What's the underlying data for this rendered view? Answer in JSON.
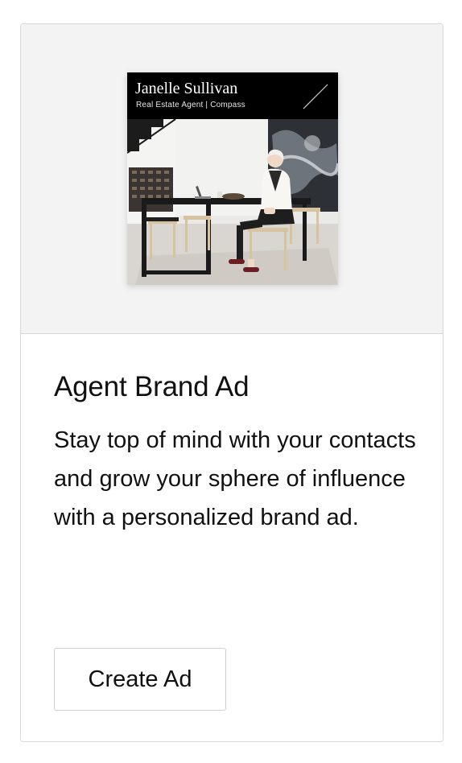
{
  "card": {
    "preview": {
      "agent_name": "Janelle Sullivan",
      "agent_role": "Real Estate Agent | Compass"
    },
    "title": "Agent Brand Ad",
    "description": "Stay top of mind with your contacts and grow your sphere of influence with a personalized brand ad.",
    "cta_label": "Create Ad"
  }
}
